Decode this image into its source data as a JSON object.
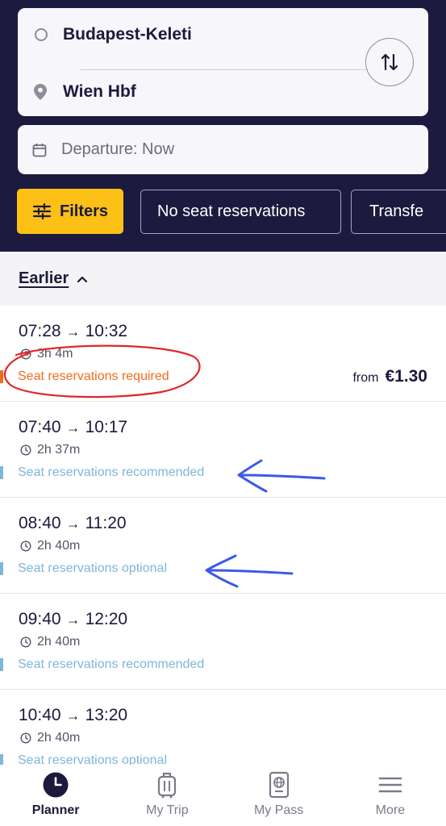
{
  "search": {
    "origin": "Budapest-Keleti",
    "destination": "Wien Hbf",
    "departure": "Departure: Now"
  },
  "filters": {
    "button_label": "Filters",
    "chips": [
      "No seat reservations",
      "Transfe"
    ]
  },
  "earlier_label": "Earlier",
  "trips": [
    {
      "dep": "07:28",
      "arr": "10:32",
      "duration": "3h 4m",
      "seat_note": "Seat reservations required",
      "seat_level": "required",
      "price_from": "from",
      "price": "€1.30"
    },
    {
      "dep": "07:40",
      "arr": "10:17",
      "duration": "2h 37m",
      "seat_note": "Seat reservations recommended",
      "seat_level": "recommended"
    },
    {
      "dep": "08:40",
      "arr": "11:20",
      "duration": "2h 40m",
      "seat_note": "Seat reservations optional",
      "seat_level": "optional"
    },
    {
      "dep": "09:40",
      "arr": "12:20",
      "duration": "2h 40m",
      "seat_note": "Seat reservations recommended",
      "seat_level": "recommended"
    },
    {
      "dep": "10:40",
      "arr": "13:20",
      "duration": "2h 40m",
      "seat_note": "Seat reservations optional",
      "seat_level": "optional"
    }
  ],
  "tabs": [
    {
      "label": "Planner",
      "icon": "clock-icon",
      "active": true
    },
    {
      "label": "My Trip",
      "icon": "luggage-icon",
      "active": false
    },
    {
      "label": "My Pass",
      "icon": "passport-icon",
      "active": false
    },
    {
      "label": "More",
      "icon": "menu-icon",
      "active": false
    }
  ],
  "colors": {
    "header_bg": "#1c1a3e",
    "filter_accent": "#fcc017",
    "required": "#f26b1d",
    "recommended": "#7fb6db",
    "annotation_red": "#e0262a",
    "annotation_blue": "#3a5ae8"
  }
}
